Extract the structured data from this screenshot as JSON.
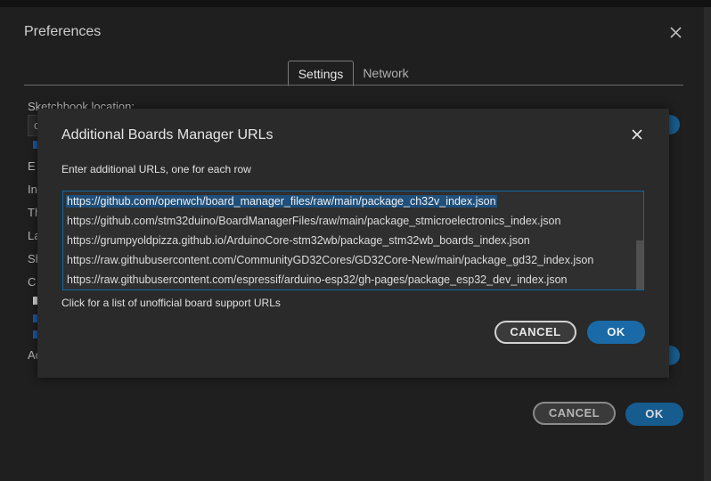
{
  "preferences": {
    "title": "Preferences",
    "tabs": [
      {
        "label": "Settings",
        "active": true
      },
      {
        "label": "Network",
        "active": false
      }
    ],
    "sketchbook_label": "Sketchbook location:",
    "sketchbook_value_partial": "c",
    "partial_labels": [
      "E",
      "In",
      "Th",
      "La",
      "Sh",
      "C",
      "Ac"
    ],
    "cancel_label": "CANCEL",
    "ok_label": "OK"
  },
  "dialog": {
    "title": "Additional Boards Manager URLs",
    "instruction": "Enter additional URLs, one for each row",
    "urls": [
      "https://github.com/openwch/board_manager_files/raw/main/package_ch32v_index.json",
      "https://github.com/stm32duino/BoardManagerFiles/raw/main/package_stmicroelectronics_index.json",
      "https://grumpyoldpizza.github.io/ArduinoCore-stm32wb/package_stm32wb_boards_index.json",
      "https://raw.githubusercontent.com/CommunityGD32Cores/GD32Core-New/main/package_gd32_index.json",
      "https://raw.githubusercontent.com/espressif/arduino-esp32/gh-pages/package_esp32_dev_index.json"
    ],
    "unofficial_link": "Click for a list of unofficial board support URLs",
    "cancel_label": "CANCEL",
    "ok_label": "OK"
  },
  "colors": {
    "accent": "#196aa6",
    "selection": "#1f4f7a",
    "dialog_bg": "#2a2a2a",
    "window_bg": "#1f1f1f"
  },
  "icons": {
    "close": "close-icon"
  }
}
